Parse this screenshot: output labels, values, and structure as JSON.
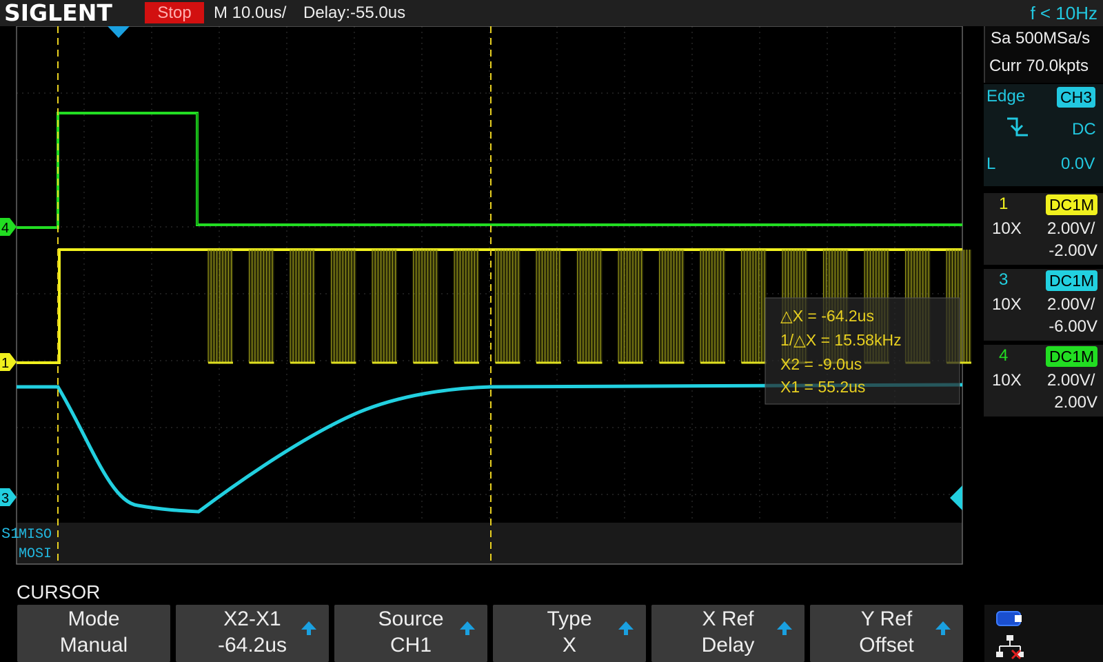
{
  "header": {
    "brand": "SIGLENT",
    "run_state": "Stop",
    "timebase": "M 10.0us/",
    "delay": "Delay:-55.0us",
    "frequency": "f < 10Hz"
  },
  "acquisition": {
    "sample_rate": "Sa 500MSa/s",
    "memory": "Curr 70.0kpts"
  },
  "trigger": {
    "type": "Edge",
    "source": "CH3",
    "coupling": "DC",
    "level_label": "L",
    "level": "0.0V"
  },
  "channels": [
    {
      "id": "1",
      "coupling": "DC1M",
      "probe": "10X",
      "scale": "2.00V/",
      "offset": "-2.00V",
      "color": "#f0f01e"
    },
    {
      "id": "3",
      "coupling": "DC1M",
      "probe": "10X",
      "scale": "2.00V/",
      "offset": "-6.00V",
      "color": "#22d0e0"
    },
    {
      "id": "4",
      "coupling": "DC1M",
      "probe": "10X",
      "scale": "2.00V/",
      "offset": "2.00V",
      "color": "#22dd22"
    }
  ],
  "cursor_readout": {
    "delta_x": "△X = -64.2us",
    "inv_delta_x": "1/△X = 15.58kHz",
    "x2": "X2 = -9.0us",
    "x1": "X1 = 55.2us"
  },
  "decode": {
    "bus_label": "S1",
    "line1": "MISO",
    "line2": "MOSI"
  },
  "menu": {
    "title": "CURSOR",
    "softkeys": [
      {
        "name": "Mode",
        "value": "Manual",
        "arrow": false
      },
      {
        "name": "X2-X1",
        "value": "-64.2us",
        "arrow": true
      },
      {
        "name": "Source",
        "value": "CH1",
        "arrow": true
      },
      {
        "name": "Type",
        "value": "X",
        "arrow": true
      },
      {
        "name": "X Ref",
        "value": "Delay",
        "arrow": true
      },
      {
        "name": "Y Ref",
        "value": "Offset",
        "arrow": true
      }
    ]
  },
  "markers": {
    "ch4": "4",
    "ch1": "1",
    "ch3": "3"
  }
}
